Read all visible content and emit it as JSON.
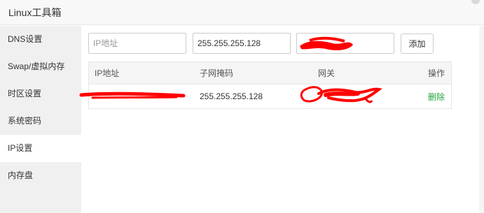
{
  "window": {
    "title": "Linux工具箱"
  },
  "sidebar": {
    "items": [
      {
        "label": "DNS设置"
      },
      {
        "label": "Swap/虚拟内存"
      },
      {
        "label": "时区设置"
      },
      {
        "label": "系统密码"
      },
      {
        "label": "IP设置",
        "active": true
      },
      {
        "label": "内存盘"
      }
    ]
  },
  "form": {
    "ip_placeholder": "IP地址",
    "mask_value": "255.255.255.128",
    "gateway_value": "",
    "add_label": "添加"
  },
  "table": {
    "headers": [
      "IP地址",
      "子网掩码",
      "网关",
      "操作"
    ],
    "rows": [
      {
        "ip": "",
        "mask": "255.255.255.128",
        "gateway": "",
        "action": "删除"
      }
    ]
  },
  "colors": {
    "accent": "#20a53a",
    "redaction": "#ff0000"
  }
}
